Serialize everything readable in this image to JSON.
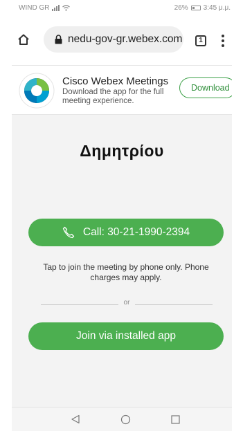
{
  "status_bar": {
    "carrier": "WIND GR",
    "battery": "26%",
    "time": "3:45 μ.μ."
  },
  "browser": {
    "url": "nedu-gov-gr.webex.com",
    "tab_count": "1",
    "icons": {
      "home": "home-icon",
      "lock": "lock-icon",
      "tabs": "tabs-icon",
      "menu": "more-vert-icon"
    }
  },
  "app_banner": {
    "title": "Cisco Webex Meetings",
    "description": "Download the app for the full meeting experience.",
    "download_label": "Download"
  },
  "meeting": {
    "title": "Δημητρίου",
    "call_label": "Call: 30-21-1990-2394",
    "phone_note": "Tap to join the meeting by phone only. Phone charges may apply.",
    "or_label": "or",
    "join_label": "Join via installed app"
  },
  "colors": {
    "accent_green": "#4caf50",
    "download_green": "#3fa14a"
  }
}
